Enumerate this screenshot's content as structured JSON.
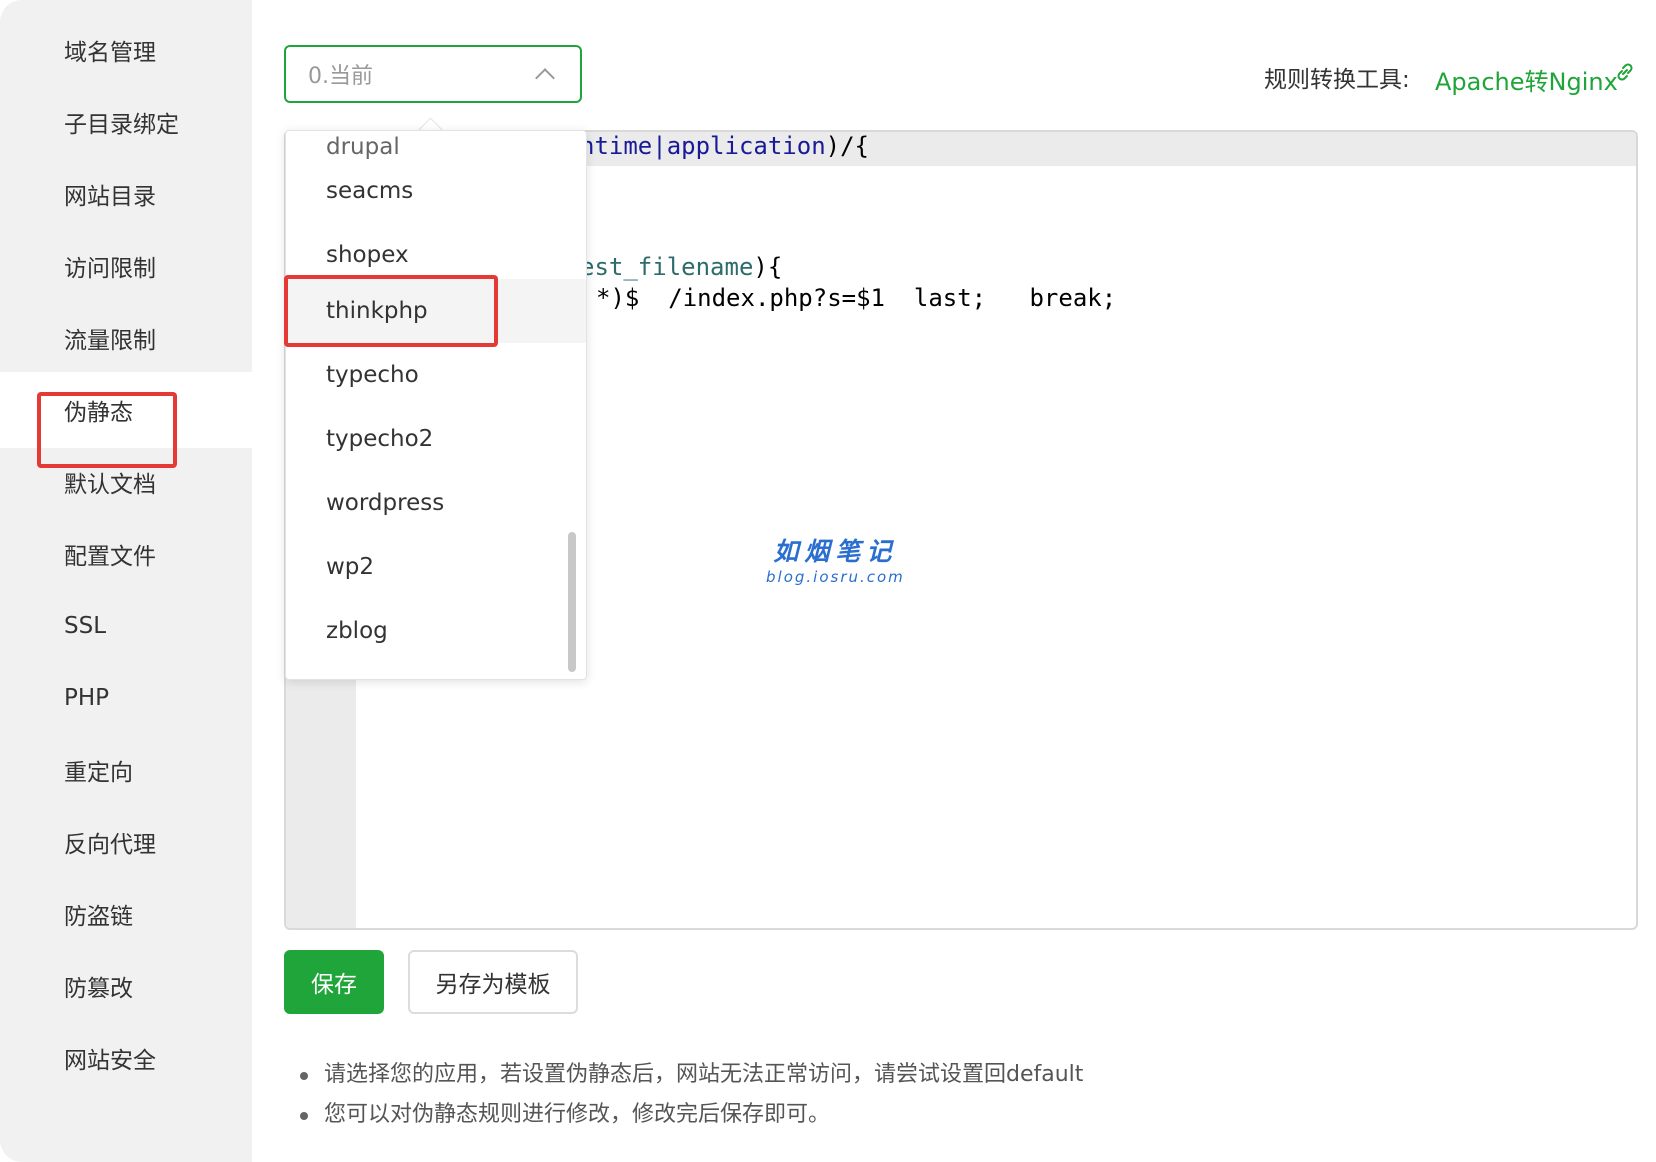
{
  "sidebar": {
    "items": [
      {
        "label": "域名管理"
      },
      {
        "label": "子目录绑定"
      },
      {
        "label": "网站目录"
      },
      {
        "label": "访问限制"
      },
      {
        "label": "流量限制"
      },
      {
        "label": "伪静态"
      },
      {
        "label": "默认文档"
      },
      {
        "label": "配置文件"
      },
      {
        "label": "SSL"
      },
      {
        "label": "PHP"
      },
      {
        "label": "重定向"
      },
      {
        "label": "反向代理"
      },
      {
        "label": "防盗链"
      },
      {
        "label": "防篡改"
      },
      {
        "label": "网站安全"
      }
    ],
    "active": "伪静态"
  },
  "select": {
    "value": "0.当前"
  },
  "dropdown": {
    "partial_option": "drupal",
    "options": [
      "seacms",
      "shopex",
      "thinkphp",
      "typecho",
      "typecho2",
      "wordpress",
      "wp2",
      "zblog"
    ],
    "highlighted": "thinkphp"
  },
  "tool": {
    "label": "规则转换工具:",
    "link": "Apache转Nginx",
    "link_icon": "external-link-icon"
  },
  "editor": {
    "line1_kw": "ntime|application",
    "line1_rest": ")/{",
    "line2_var": "est_filename",
    "line2_rest": "){",
    "line3": "*)$  /index.php?s=$1  last;   break;"
  },
  "watermark": {
    "title": "如烟笔记",
    "subtitle": "blog.iosru.com"
  },
  "buttons": {
    "save": "保存",
    "save_as_template": "另存为模板"
  },
  "tips": [
    "请选择您的应用，若设置伪静态后，网站无法正常访问，请尝试设置回default",
    "您可以对伪静态规则进行修改，修改完后保存即可。"
  ],
  "colors": {
    "accent": "#20a53a",
    "highlight_border": "#e53935",
    "sidebar_bg": "#f1f1f1"
  }
}
